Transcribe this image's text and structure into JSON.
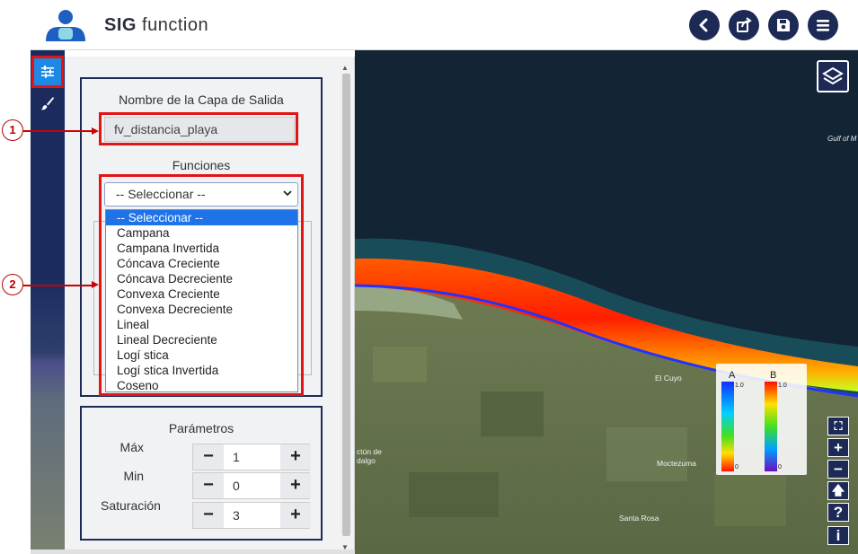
{
  "header": {
    "app_name_bold": "SIG",
    "app_name_rest": "function",
    "buttons": [
      "back-icon",
      "share-icon",
      "save-icon",
      "menu-icon"
    ]
  },
  "iconbar": {
    "items": [
      "sliders-icon",
      "brush-icon"
    ]
  },
  "panel": {
    "output_layer_label": "Nombre de la Capa de Salida",
    "output_layer_value": "fv_distancia_playa",
    "functions_label": "Funciones",
    "select_value": "-- Seleccionar --",
    "options": [
      "-- Seleccionar --",
      "Campana",
      "Campana Invertida",
      "Cóncava Creciente",
      "Cóncava Decreciente",
      "Convexa Creciente",
      "Convexa Decreciente",
      "Lineal",
      "Lineal Decreciente",
      "Logí stica",
      "Logí stica Invertida",
      "Coseno"
    ],
    "params_title": "Parámetros",
    "params": [
      {
        "label": "Máx",
        "value": "1",
        "minus": "−",
        "plus": "+"
      },
      {
        "label": "Min",
        "value": "0",
        "minus": "−",
        "plus": "+"
      },
      {
        "label": "Saturación",
        "value": "3",
        "minus": "−",
        "plus": "+"
      }
    ]
  },
  "callouts": [
    "1",
    "2"
  ],
  "map": {
    "gulf_label": "Gulf of M",
    "places": [
      "El Cuyo",
      "Moctezuma",
      "Santa Rosa",
      "ctún de",
      "dalgo"
    ],
    "legend": {
      "a_title": "A",
      "b_title": "B",
      "a_max": "1.0",
      "a_min": "0",
      "b_max": "1.0",
      "b_min": "0"
    },
    "zoom_buttons": [
      "⛶",
      "+",
      "−",
      "🡅",
      "?",
      "i"
    ]
  }
}
